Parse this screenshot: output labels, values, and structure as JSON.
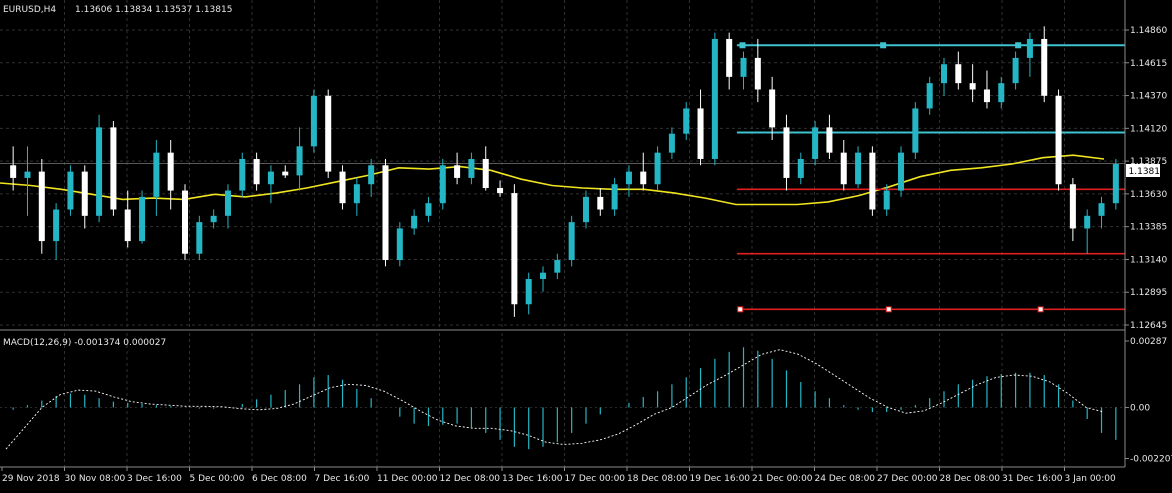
{
  "header": {
    "symbol": "EURUSD,H4",
    "ohlc": "1.13606 1.13834 1.13537 1.13815"
  },
  "colors": {
    "bull": "#25b6c6",
    "bear": "#ffffff",
    "ma": "#f0e520",
    "macd_hist": "#25b6c6",
    "macd_signal": "#ffffff",
    "trend_cyan": "#3fc3d0",
    "trend_red": "#e02020",
    "grid": "#303030",
    "price_badge": "#ffffff"
  },
  "chart_data": [
    {
      "type": "candlestick",
      "symbol": "EURUSD",
      "timeframe": "H4",
      "ylim": [
        1.1252,
        1.1495
      ],
      "price_ticks": [
        "1.14860",
        "1.14615",
        "1.14370",
        "1.14120",
        "1.13875",
        "1.13630",
        "1.13385",
        "1.13140",
        "1.12895",
        "1.12645"
      ],
      "current_price": "1.13815",
      "x_ticks": [
        "29 Nov 2018",
        "30 Nov 08:00",
        "3 Dec 16:00",
        "5 Dec 00:00",
        "6 Dec 08:00",
        "7 Dec 16:00",
        "11 Dec 00:00",
        "12 Dec 08:00",
        "13 Dec 16:00",
        "17 Dec 00:00",
        "18 Dec 08:00",
        "19 Dec 16:00",
        "21 Dec 00:00",
        "24 Dec 08:00",
        "27 Dec 00:00",
        "28 Dec 08:00",
        "31 Dec 16:00",
        "3 Jan 00:00"
      ],
      "grid": true,
      "series": [
        {
          "kind": "moving_average",
          "values": [
            1.1366,
            1.1364,
            1.1361,
            1.1357,
            1.1353,
            1.1354,
            1.1353,
            1.1357,
            1.1355,
            1.1358,
            1.1362,
            1.1367,
            1.1372,
            1.1378,
            1.1377,
            1.1379,
            1.1376,
            1.1369,
            1.1364,
            1.1362,
            1.1361,
            1.1361,
            1.1358,
            1.1354,
            1.1349,
            1.1349,
            1.1349,
            1.1351,
            1.1356,
            1.1363,
            1.1371,
            1.1376,
            1.1378,
            1.1381,
            1.1386,
            1.1388,
            1.1385
          ]
        },
        {
          "kind": "candles",
          "points": [
            [
              1.138,
              1.1395,
              1.136,
              1.137
            ],
            [
              1.137,
              1.1395,
              1.134,
              1.1375
            ],
            [
              1.1375,
              1.1385,
              1.131,
              1.132
            ],
            [
              1.132,
              1.135,
              1.1305,
              1.1345
            ],
            [
              1.1345,
              1.138,
              1.134,
              1.1375
            ],
            [
              1.1375,
              1.138,
              1.133,
              1.134
            ],
            [
              1.134,
              1.142,
              1.1335,
              1.141
            ],
            [
              1.141,
              1.1415,
              1.134,
              1.1345
            ],
            [
              1.1345,
              1.136,
              1.1315,
              1.132
            ],
            [
              1.132,
              1.136,
              1.1318,
              1.1355
            ],
            [
              1.1355,
              1.14,
              1.134,
              1.139
            ],
            [
              1.139,
              1.14,
              1.1345,
              1.136
            ],
            [
              1.136,
              1.1365,
              1.1305,
              1.131
            ],
            [
              1.131,
              1.134,
              1.1305,
              1.1335
            ],
            [
              1.1335,
              1.1345,
              1.133,
              1.134
            ],
            [
              1.134,
              1.1365,
              1.133,
              1.136
            ],
            [
              1.136,
              1.139,
              1.1355,
              1.1385
            ],
            [
              1.1385,
              1.139,
              1.136,
              1.1365
            ],
            [
              1.1365,
              1.138,
              1.135,
              1.1375
            ],
            [
              1.1375,
              1.138,
              1.137,
              1.1372
            ],
            [
              1.1372,
              1.141,
              1.136,
              1.1395
            ],
            [
              1.1395,
              1.144,
              1.139,
              1.1435
            ],
            [
              1.1435,
              1.144,
              1.137,
              1.1375
            ],
            [
              1.1375,
              1.138,
              1.1345,
              1.135
            ],
            [
              1.135,
              1.137,
              1.134,
              1.1365
            ],
            [
              1.1365,
              1.1385,
              1.1355,
              1.138
            ],
            [
              1.138,
              1.1385,
              1.13,
              1.1305
            ],
            [
              1.1305,
              1.1335,
              1.13,
              1.133
            ],
            [
              1.133,
              1.1345,
              1.1325,
              1.134
            ],
            [
              1.134,
              1.1355,
              1.1335,
              1.135
            ],
            [
              1.135,
              1.1385,
              1.1345,
              1.138
            ],
            [
              1.138,
              1.139,
              1.1365,
              1.137
            ],
            [
              1.137,
              1.139,
              1.1365,
              1.1385
            ],
            [
              1.1385,
              1.1395,
              1.136,
              1.1362
            ],
            [
              1.1362,
              1.1368,
              1.1355,
              1.1358
            ],
            [
              1.1358,
              1.1365,
              1.126,
              1.127
            ],
            [
              1.127,
              1.1295,
              1.1262,
              1.129
            ],
            [
              1.129,
              1.13,
              1.128,
              1.1295
            ],
            [
              1.1295,
              1.131,
              1.129,
              1.1305
            ],
            [
              1.1305,
              1.134,
              1.13,
              1.1335
            ],
            [
              1.1335,
              1.136,
              1.133,
              1.1355
            ],
            [
              1.1355,
              1.1362,
              1.134,
              1.1345
            ],
            [
              1.1345,
              1.137,
              1.134,
              1.1365
            ],
            [
              1.1365,
              1.138,
              1.1355,
              1.1375
            ],
            [
              1.1375,
              1.139,
              1.136,
              1.1365
            ],
            [
              1.1365,
              1.1395,
              1.136,
              1.139
            ],
            [
              1.139,
              1.141,
              1.1385,
              1.1405
            ],
            [
              1.1405,
              1.143,
              1.14,
              1.1425
            ],
            [
              1.1425,
              1.144,
              1.138,
              1.1385
            ],
            [
              1.1385,
              1.1485,
              1.138,
              1.148
            ],
            [
              1.148,
              1.1485,
              1.144,
              1.145
            ],
            [
              1.145,
              1.147,
              1.144,
              1.1465
            ],
            [
              1.1465,
              1.148,
              1.143,
              1.144
            ],
            [
              1.144,
              1.145,
              1.14,
              1.141
            ],
            [
              1.141,
              1.142,
              1.136,
              1.137
            ],
            [
              1.137,
              1.139,
              1.1365,
              1.1385
            ],
            [
              1.1385,
              1.1415,
              1.138,
              1.141
            ],
            [
              1.141,
              1.142,
              1.1385,
              1.139
            ],
            [
              1.139,
              1.14,
              1.136,
              1.1365
            ],
            [
              1.1365,
              1.1395,
              1.1362,
              1.139
            ],
            [
              1.139,
              1.1395,
              1.134,
              1.1345
            ],
            [
              1.1345,
              1.1365,
              1.134,
              1.136
            ],
            [
              1.136,
              1.1395,
              1.1355,
              1.139
            ],
            [
              1.139,
              1.143,
              1.1385,
              1.1425
            ],
            [
              1.1425,
              1.145,
              1.142,
              1.1445
            ],
            [
              1.1445,
              1.1465,
              1.1435,
              1.146
            ],
            [
              1.146,
              1.147,
              1.144,
              1.1445
            ],
            [
              1.1445,
              1.146,
              1.143,
              1.144
            ],
            [
              1.144,
              1.1455,
              1.1425,
              1.143
            ],
            [
              1.143,
              1.145,
              1.1425,
              1.1445
            ],
            [
              1.1445,
              1.147,
              1.144,
              1.1465
            ],
            [
              1.1465,
              1.1485,
              1.145,
              1.148
            ],
            [
              1.148,
              1.149,
              1.143,
              1.1435
            ],
            [
              1.1435,
              1.144,
              1.136,
              1.1365
            ],
            [
              1.1365,
              1.137,
              1.132,
              1.133
            ],
            [
              1.133,
              1.1345,
              1.131,
              1.134
            ],
            [
              1.134,
              1.1355,
              1.133,
              1.135
            ],
            [
              1.135,
              1.1385,
              1.1345,
              1.1381
            ]
          ]
        }
      ],
      "trendlines": [
        {
          "color": "cyan",
          "from": [
            0.655,
            1.1475
          ],
          "to": [
            1.0,
            1.1475
          ]
        },
        {
          "color": "cyan",
          "from": [
            0.655,
            1.1406
          ],
          "to": [
            1.0,
            1.1406
          ]
        },
        {
          "color": "red",
          "from": [
            0.655,
            1.1361
          ],
          "to": [
            1.0,
            1.1361
          ]
        },
        {
          "color": "red",
          "from": [
            0.655,
            1.131
          ],
          "to": [
            1.0,
            1.131
          ]
        },
        {
          "color": "red",
          "from": [
            0.655,
            1.1266
          ],
          "to": [
            1.0,
            1.1266
          ]
        }
      ]
    },
    {
      "type": "bar+line",
      "title": "MACD(12,26,9) -0.001374 0.000027",
      "ylim": [
        -0.0024,
        0.003
      ],
      "y_ticks": [
        "0.00287",
        "0.00",
        "-0.002207"
      ],
      "histogram": [
        -0.0001,
        0.0001,
        0.0003,
        0.0005,
        0.0006,
        0.00055,
        0.0004,
        0.00025,
        0.0002,
        0.00015,
        0.0001,
        5e-05,
        0.0,
        -5e-05,
        -5e-05,
        0.0,
        0.00015,
        0.00035,
        0.00055,
        0.00075,
        0.001,
        0.0013,
        0.0014,
        0.0012,
        0.0008,
        0.0004,
        0.0,
        -0.0004,
        -0.0007,
        -0.0008,
        -0.00075,
        -0.0007,
        -0.00085,
        -0.0011,
        -0.0014,
        -0.0017,
        -0.0018,
        -0.0017,
        -0.0015,
        -0.0011,
        -0.0007,
        -0.0003,
        0.0,
        0.0002,
        0.00045,
        0.0007,
        0.001,
        0.0013,
        0.0017,
        0.0021,
        0.0024,
        0.0026,
        0.00245,
        0.0021,
        0.0016,
        0.0011,
        0.0007,
        0.0004,
        0.0001,
        -0.0001,
        -0.0002,
        -0.0002,
        -0.0001,
        0.0001,
        0.0004,
        0.0007,
        0.001,
        0.0012,
        0.00135,
        0.00145,
        0.0015,
        0.0015,
        0.0014,
        0.001,
        0.0003,
        -0.0005,
        -0.0011,
        -0.0014
      ],
      "signal": [
        -0.0018,
        -0.0009,
        0.0,
        0.00055,
        0.00075,
        0.0007,
        0.00045,
        0.00025,
        0.00015,
        0.0001,
        5e-05,
        5e-05,
        3e-05,
        -5e-05,
        -0.0001,
        -5e-05,
        0.00015,
        0.0005,
        0.00085,
        0.001,
        0.00095,
        0.0007,
        0.0003,
        -0.00015,
        -0.00055,
        -0.0008,
        -0.0009,
        -0.0009,
        -0.001,
        -0.0012,
        -0.0015,
        -0.0016,
        -0.00155,
        -0.0014,
        -0.00115,
        -0.00075,
        -0.0003,
        0.0,
        0.0005,
        0.001,
        0.0014,
        0.00185,
        0.0023,
        0.0025,
        0.0023,
        0.0019,
        0.0014,
        0.0009,
        0.0004,
        0.0,
        -0.00025,
        -0.00015,
        0.0002,
        0.0006,
        0.001,
        0.0013,
        0.0014,
        0.00135,
        0.0011,
        0.0006,
        0.0,
        -0.0002
      ]
    }
  ]
}
